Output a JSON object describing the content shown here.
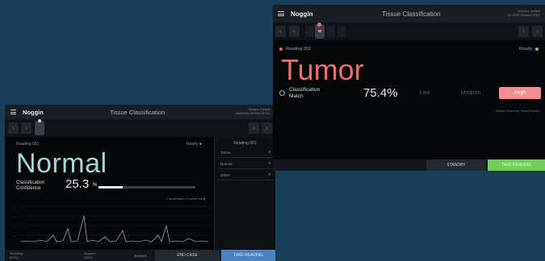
{
  "left_window": {
    "brand": "Noggin",
    "title": "Tissue Classification",
    "meta_line1": "Session Details",
    "meta_line2": "NOGGIN SESSION 001",
    "reading_label": "Reading 001",
    "ready_label": "Ready",
    "classification": "Normal",
    "classification_label_line1": "Classification",
    "classification_label_line2": "Confidence",
    "confidence_value": "25.3",
    "confidence_unit": "%",
    "confidence_fraction": 0.253,
    "chart_legend": "Classification Confidence",
    "sidebar": {
      "header": "Reading 001",
      "items": [
        {
          "name": "Tumor",
          "count": "0"
        },
        {
          "name": "Normal",
          "count": "0"
        },
        {
          "name": "Other",
          "count": "0"
        }
      ]
    },
    "footer": {
      "stat1_label": "Readings",
      "stat1_value": "00001",
      "stat2_label": "Elapsed",
      "stat2_value": "00001",
      "stat3": "00:00:01",
      "end_button": "END CASE",
      "take_button": "TAKE READING"
    }
  },
  "right_window": {
    "brand": "Noggin",
    "title": "Tissue Classification",
    "meta_line1": "Session Details",
    "meta_line2": "ID: 0000 Session 0007",
    "reading_label": "Reading 002",
    "ready_label": "Ready",
    "classification": "Tumor",
    "classification_label_line1": "Classification",
    "classification_label_line2": "Match",
    "confidence_value": "75.4%",
    "levels": {
      "low": "Low",
      "medium": "Medium",
      "high": "High"
    },
    "note": "Surface Reference: Ready/Normal",
    "footer": {
      "standby_button": "STANDBY",
      "take_button": "TAKE READING"
    }
  },
  "colors": {
    "background": "#173f57",
    "normal_accent": "#a6d7d3",
    "tumor_accent": "#ef6f6f",
    "high_level": "#f28d8d",
    "take_reading_blue": "#4a82c2",
    "take_reading_green": "#6fcf57"
  }
}
